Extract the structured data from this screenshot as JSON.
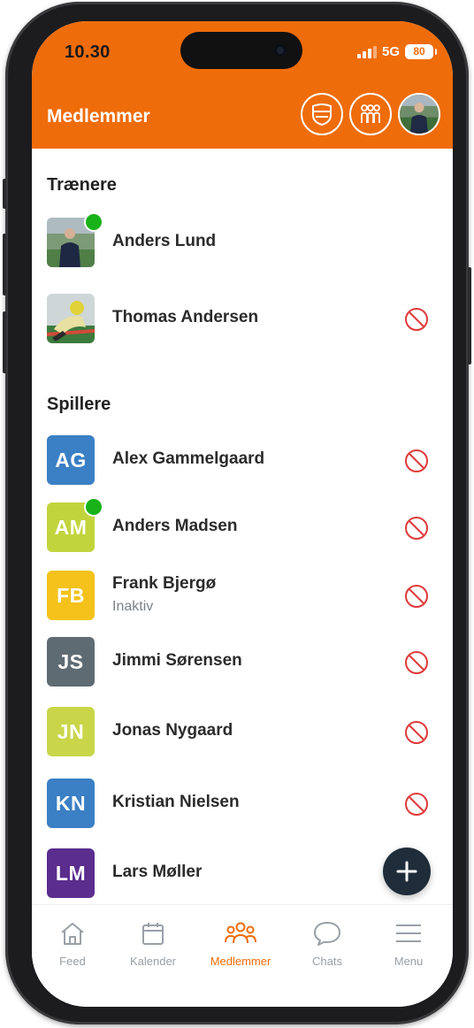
{
  "status_bar": {
    "time": "10.30",
    "network": "5G",
    "battery": "80"
  },
  "header": {
    "title": "Medlemmer"
  },
  "sections": {
    "coaches": {
      "title": "Trænere"
    },
    "players": {
      "title": "Spillere"
    }
  },
  "coaches": [
    {
      "name": "Anders Lund",
      "online": true,
      "has_ban_icon": false
    },
    {
      "name": "Thomas Andersen",
      "online": false,
      "has_ban_icon": true
    }
  ],
  "players": [
    {
      "initials": "AG",
      "name": "Alex Gammelgaard",
      "color": "#3b7fc4",
      "online": false
    },
    {
      "initials": "AM",
      "name": "Anders Madsen",
      "color": "#c2d43c",
      "online": true
    },
    {
      "initials": "FB",
      "name": "Frank Bjergø",
      "status": "Inaktiv",
      "color": "#f4c21a",
      "online": false
    },
    {
      "initials": "JS",
      "name": "Jimmi Sørensen",
      "color": "#5f6b73",
      "online": false
    },
    {
      "initials": "JN",
      "name": "Jonas Nygaard",
      "color": "#c9d64a",
      "online": false
    },
    {
      "initials": "KN",
      "name": "Kristian Nielsen",
      "color": "#3b7fc4",
      "online": false
    },
    {
      "initials": "LM",
      "name": "Lars Møller",
      "color": "#5b2d8e",
      "online": false
    }
  ],
  "tabs": [
    {
      "label": "Feed",
      "icon": "home-icon",
      "active": false
    },
    {
      "label": "Kalender",
      "icon": "calendar-icon",
      "active": false
    },
    {
      "label": "Medlemmer",
      "icon": "members-icon",
      "active": true
    },
    {
      "label": "Chats",
      "icon": "chat-bubble-icon",
      "active": false
    },
    {
      "label": "Menu",
      "icon": "hamburger-icon",
      "active": false
    }
  ],
  "colors": {
    "brand": "#ef6c0a",
    "online": "#19b219",
    "ban": "#e03a3a",
    "fab": "#1f2d3a"
  }
}
